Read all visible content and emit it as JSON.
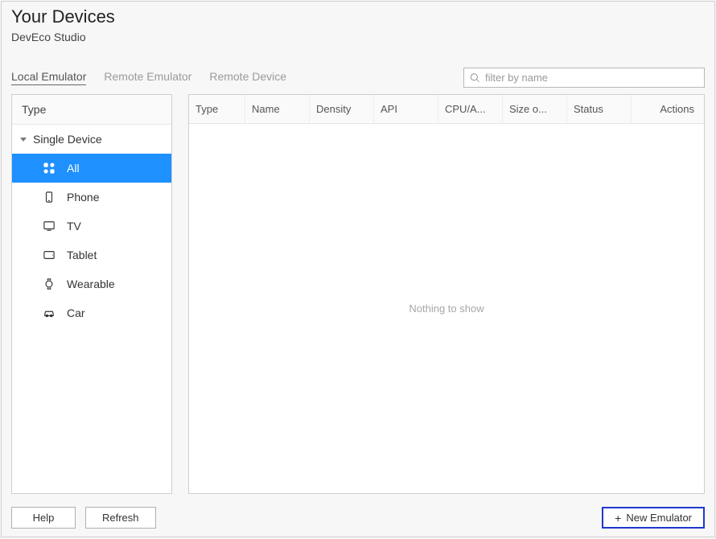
{
  "header": {
    "title": "Your Devices",
    "subtitle": "DevEco Studio"
  },
  "tabs": {
    "local": "Local Emulator",
    "remote_emu": "Remote Emulator",
    "remote_dev": "Remote Device"
  },
  "search": {
    "placeholder": "filter by name"
  },
  "sidebar": {
    "header": "Type",
    "group": "Single Device",
    "items": [
      {
        "label": "All"
      },
      {
        "label": "Phone"
      },
      {
        "label": "TV"
      },
      {
        "label": "Tablet"
      },
      {
        "label": "Wearable"
      },
      {
        "label": "Car"
      }
    ]
  },
  "table": {
    "columns": [
      "Type",
      "Name",
      "Density",
      "API",
      "CPU/A...",
      "Size o...",
      "Status",
      "Actions"
    ],
    "empty_text": "Nothing to show"
  },
  "footer": {
    "help": "Help",
    "refresh": "Refresh",
    "new_emulator": "New Emulator"
  }
}
